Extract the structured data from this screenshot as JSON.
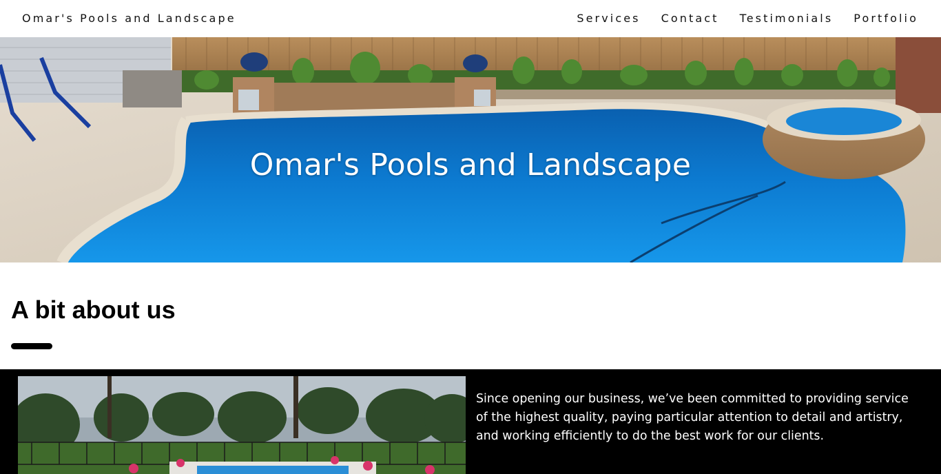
{
  "header": {
    "brand": "Omar's Pools and Landscape",
    "nav": [
      "Services",
      "Contact",
      "Testimonials",
      "Portfolio"
    ]
  },
  "hero": {
    "title": "Omar's Pools and Landscape"
  },
  "about": {
    "heading": "A bit about us",
    "body": "Since opening our business, we’ve been committed to providing service of the highest quality, paying particular attention to detail and artistry, and working efficiently to do the best work for our clients."
  },
  "colors": {
    "background": "#ffffff",
    "band": "#000000",
    "pool_blue": "#0a7fd0",
    "text": "#111111"
  }
}
